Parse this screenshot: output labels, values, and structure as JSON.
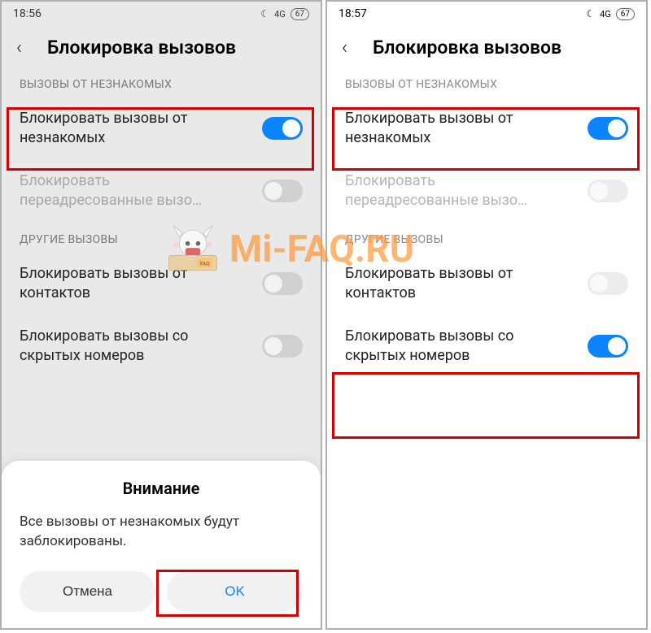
{
  "watermark": {
    "text": "Mi-FAQ.RU"
  },
  "left": {
    "status": {
      "time": "18:56",
      "network": "4G",
      "battery": "67"
    },
    "header": {
      "title": "Блокировка вызовов"
    },
    "section1": {
      "label": "ВЫЗОВЫ ОТ НЕЗНАКОМЫХ"
    },
    "row_block_unknown": {
      "label": "Блокировать вызовы от незнакомых",
      "on": true
    },
    "row_forwarded": {
      "label": "Блокировать переадресованные вызо…",
      "on": false
    },
    "section2": {
      "label": "ДРУГИЕ ВЫЗОВЫ"
    },
    "row_contacts": {
      "label": "Блокировать вызовы от контактов",
      "on": false
    },
    "row_hidden": {
      "label": "Блокировать вызовы со скрытых номеров",
      "on": false
    },
    "dialog": {
      "title": "Внимание",
      "body": "Все вызовы от незнакомых будут заблокированы.",
      "cancel": "Отмена",
      "ok": "OK"
    }
  },
  "right": {
    "status": {
      "time": "18:57",
      "network": "4G",
      "battery": "67"
    },
    "header": {
      "title": "Блокировка вызовов"
    },
    "section1": {
      "label": "ВЫЗОВЫ ОТ НЕЗНАКОМЫХ"
    },
    "row_block_unknown": {
      "label": "Блокировать вызовы от незнакомых",
      "on": true
    },
    "row_forwarded": {
      "label": "Блокировать переадресованные вызо…",
      "on": false
    },
    "section2": {
      "label": "ДРУГИЕ ВЫЗОВЫ"
    },
    "row_contacts": {
      "label": "Блокировать вызовы от контактов",
      "on": false
    },
    "row_hidden": {
      "label": "Блокировать вызовы со скрытых номеров",
      "on": true
    }
  }
}
